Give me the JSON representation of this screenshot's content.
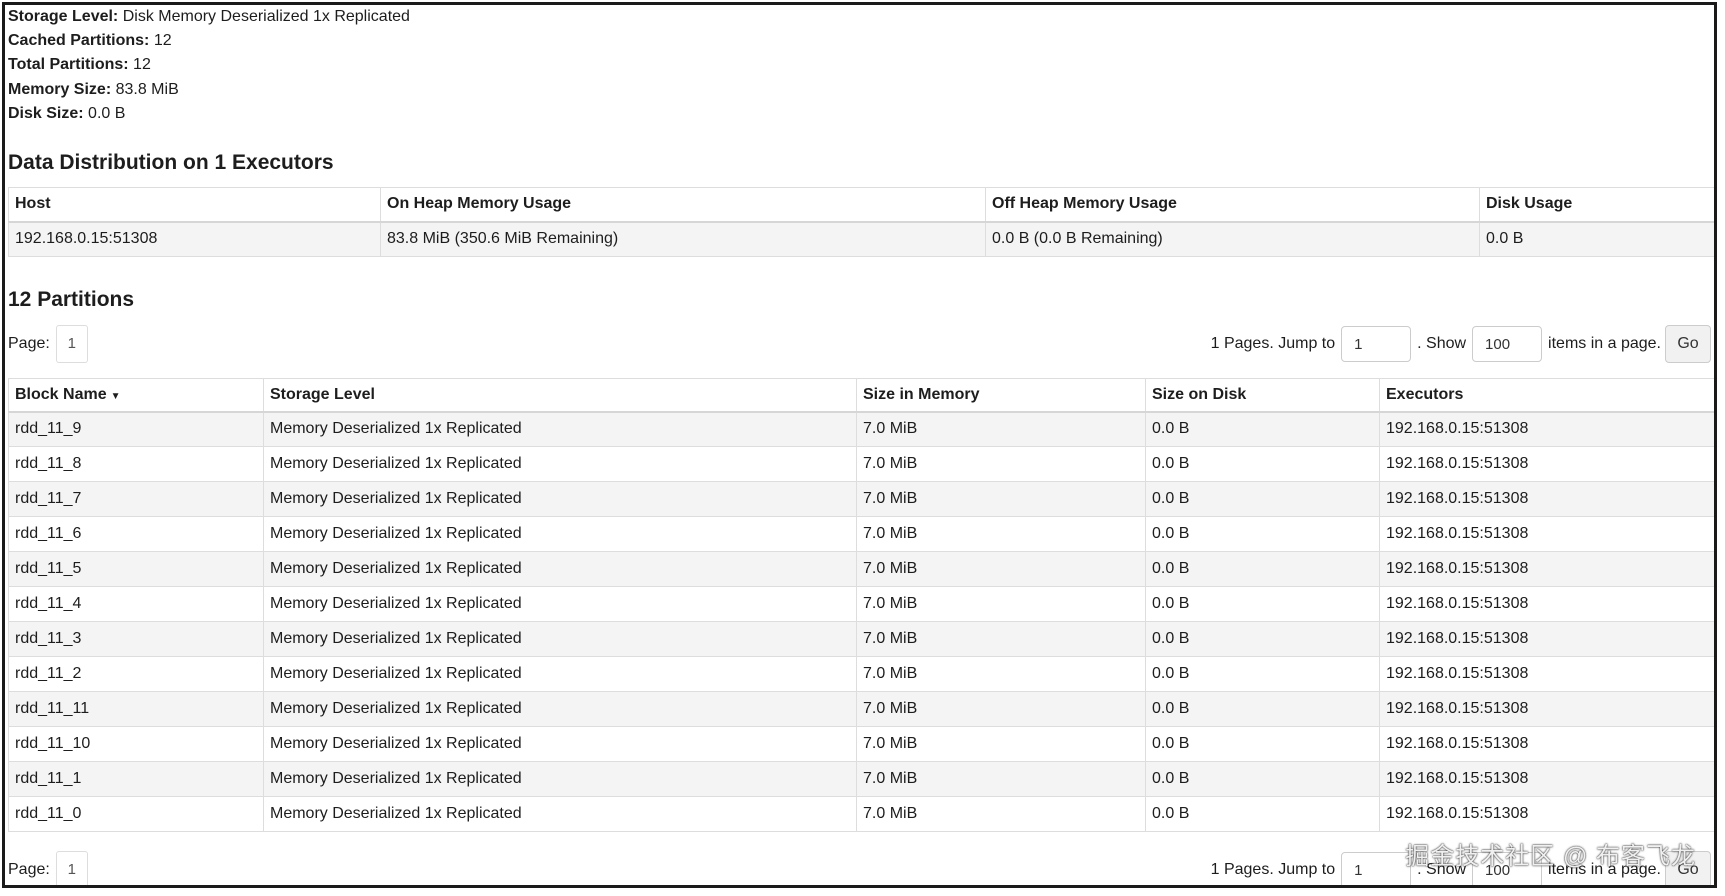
{
  "summary": [
    {
      "key": "Storage Level:",
      "value": "Disk Memory Deserialized 1x Replicated"
    },
    {
      "key": "Cached Partitions:",
      "value": "12"
    },
    {
      "key": "Total Partitions:",
      "value": "12"
    },
    {
      "key": "Memory Size:",
      "value": "83.8 MiB"
    },
    {
      "key": "Disk Size:",
      "value": "0.0 B"
    }
  ],
  "distribution": {
    "title": "Data Distribution on 1 Executors",
    "headers": [
      "Host",
      "On Heap Memory Usage",
      "Off Heap Memory Usage",
      "Disk Usage"
    ],
    "rows": [
      [
        "192.168.0.15:51308",
        "83.8 MiB (350.6 MiB Remaining)",
        "0.0 B (0.0 B Remaining)",
        "0.0 B"
      ]
    ]
  },
  "partitions": {
    "title": "12 Partitions",
    "headers": [
      "Block Name",
      "Storage Level",
      "Size in Memory",
      "Size on Disk",
      "Executors"
    ],
    "sort_indicator": "▼",
    "rows": [
      [
        "rdd_11_9",
        "Memory Deserialized 1x Replicated",
        "7.0 MiB",
        "0.0 B",
        "192.168.0.15:51308"
      ],
      [
        "rdd_11_8",
        "Memory Deserialized 1x Replicated",
        "7.0 MiB",
        "0.0 B",
        "192.168.0.15:51308"
      ],
      [
        "rdd_11_7",
        "Memory Deserialized 1x Replicated",
        "7.0 MiB",
        "0.0 B",
        "192.168.0.15:51308"
      ],
      [
        "rdd_11_6",
        "Memory Deserialized 1x Replicated",
        "7.0 MiB",
        "0.0 B",
        "192.168.0.15:51308"
      ],
      [
        "rdd_11_5",
        "Memory Deserialized 1x Replicated",
        "7.0 MiB",
        "0.0 B",
        "192.168.0.15:51308"
      ],
      [
        "rdd_11_4",
        "Memory Deserialized 1x Replicated",
        "7.0 MiB",
        "0.0 B",
        "192.168.0.15:51308"
      ],
      [
        "rdd_11_3",
        "Memory Deserialized 1x Replicated",
        "7.0 MiB",
        "0.0 B",
        "192.168.0.15:51308"
      ],
      [
        "rdd_11_2",
        "Memory Deserialized 1x Replicated",
        "7.0 MiB",
        "0.0 B",
        "192.168.0.15:51308"
      ],
      [
        "rdd_11_11",
        "Memory Deserialized 1x Replicated",
        "7.0 MiB",
        "0.0 B",
        "192.168.0.15:51308"
      ],
      [
        "rdd_11_10",
        "Memory Deserialized 1x Replicated",
        "7.0 MiB",
        "0.0 B",
        "192.168.0.15:51308"
      ],
      [
        "rdd_11_1",
        "Memory Deserialized 1x Replicated",
        "7.0 MiB",
        "0.0 B",
        "192.168.0.15:51308"
      ],
      [
        "rdd_11_0",
        "Memory Deserialized 1x Replicated",
        "7.0 MiB",
        "0.0 B",
        "192.168.0.15:51308"
      ]
    ]
  },
  "pager": {
    "page_label": "Page:",
    "current_page": "1",
    "pages_text": "1 Pages. Jump to",
    "jump_value": "1",
    "show_text": ". Show",
    "show_value": "100",
    "items_text": "items in a page.",
    "go_label": "Go"
  },
  "watermark": "掘金技术社区 @ 布客飞龙"
}
